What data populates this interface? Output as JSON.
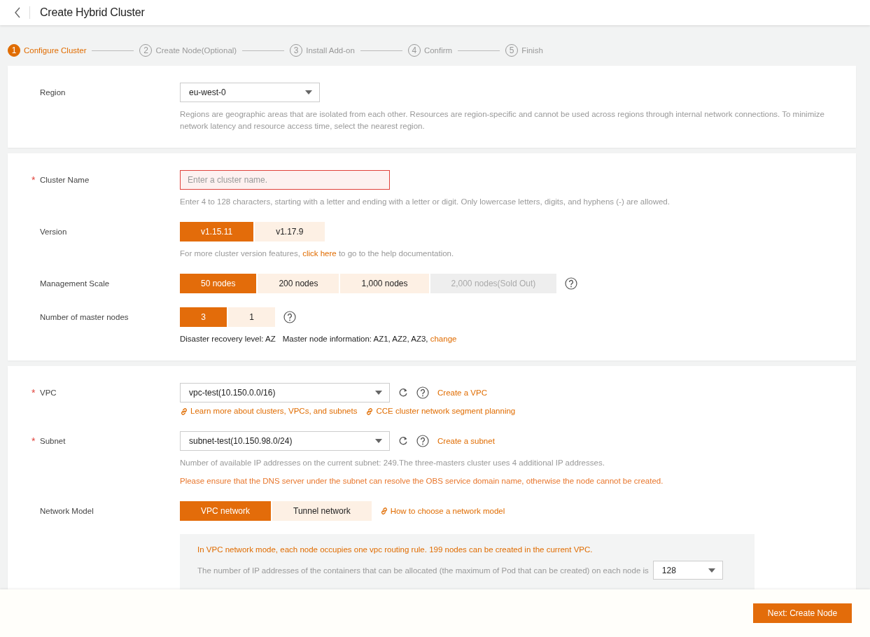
{
  "header": {
    "title": "Create Hybrid Cluster"
  },
  "steps": [
    {
      "number": "1",
      "label": "Configure Cluster",
      "selected": true
    },
    {
      "number": "2",
      "label": "Create Node(Optional)",
      "selected": false
    },
    {
      "number": "3",
      "label": "Install Add-on",
      "selected": false
    },
    {
      "number": "4",
      "label": "Confirm",
      "selected": false
    },
    {
      "number": "5",
      "label": "Finish",
      "selected": false
    }
  ],
  "sections": [
    {
      "rows": [
        {
          "label": "Region",
          "control": {
            "kind": "select",
            "value": "eu-west-0"
          },
          "notes": [
            {
              "kind": "hint",
              "parts": [
                {
                  "kind": "text",
                  "text": "Regions are geographic areas that are isolated from each other. Resources are region-specific and cannot be used across regions through internal network connections. To minimize network latency and resource access time, select the nearest region."
                }
              ]
            }
          ]
        }
      ]
    },
    {
      "rows": [
        {
          "label": "Cluster Name",
          "required_mark": "*",
          "control": {
            "kind": "input",
            "placeholder": "Enter a cluster name.",
            "invalid": true
          },
          "notes": [
            {
              "kind": "hint",
              "parts": [
                {
                  "kind": "text",
                  "text": "Enter 4 to 128 characters, starting with a letter and ending with a letter or digit. Only lowercase letters, digits, and hyphens (-) are allowed."
                }
              ]
            }
          ]
        },
        {
          "label": "Version",
          "control": {
            "kind": "segmented",
            "options": [
              {
                "label": "v1.15.11",
                "selected": true,
                "disabled": false
              },
              {
                "label": "v1.17.9",
                "selected": false,
                "disabled": false
              }
            ]
          },
          "notes": [
            {
              "kind": "hint",
              "parts": [
                {
                  "kind": "text",
                  "text": "For more cluster version features, "
                },
                {
                  "kind": "link",
                  "text": "click here"
                },
                {
                  "kind": "text",
                  "text": " to go to the help documentation."
                }
              ]
            }
          ]
        },
        {
          "label": "Management Scale",
          "control": {
            "kind": "segmented",
            "help": true,
            "options": [
              {
                "label": "50 nodes",
                "selected": true,
                "disabled": false
              },
              {
                "label": "200 nodes",
                "selected": false,
                "disabled": false
              },
              {
                "label": "1,000 nodes",
                "selected": false,
                "disabled": false
              },
              {
                "label": "2,000 nodes(Sold Out)",
                "selected": false,
                "disabled": true
              }
            ]
          }
        },
        {
          "label": "Number of master nodes",
          "control": {
            "kind": "segmented",
            "help": true,
            "options": [
              {
                "label": "3",
                "selected": true,
                "disabled": false
              },
              {
                "label": "1",
                "selected": false,
                "disabled": false
              }
            ]
          },
          "notes": [
            {
              "kind": "dark",
              "parts": [
                {
                  "kind": "text",
                  "text": "Disaster recovery level: AZ"
                },
                {
                  "kind": "text",
                  "text": "Master node information: AZ1, AZ2, AZ3, "
                },
                {
                  "kind": "link",
                  "text": "change"
                }
              ]
            }
          ]
        }
      ]
    },
    {
      "rows": [
        {
          "label": "VPC",
          "required_mark": "*",
          "control": {
            "kind": "select",
            "value": "vpc-test(10.150.0.0/16)",
            "refresh": true,
            "help": true,
            "link": "Create a VPC"
          },
          "notes": [
            {
              "kind": "links",
              "parts": [
                {
                  "kind": "link",
                  "text": "Learn more about clusters, VPCs, and subnets"
                },
                {
                  "kind": "link",
                  "text": "CCE cluster network segment planning"
                }
              ]
            }
          ]
        },
        {
          "label": "Subnet",
          "required_mark": "*",
          "control": {
            "kind": "select",
            "value": "subnet-test(10.150.98.0/24)",
            "refresh": true,
            "help": true,
            "link": "Create a subnet"
          },
          "notes": [
            {
              "kind": "hint",
              "parts": [
                {
                  "kind": "text",
                  "text": "Number of available IP addresses on the current subnet: 249.The three-masters cluster uses 4 additional IP addresses."
                }
              ]
            },
            {
              "kind": "warning",
              "parts": [
                {
                  "kind": "text",
                  "text": "Please ensure that the DNS server under the subnet can resolve the OBS service domain name, otherwise the node cannot be created."
                }
              ]
            }
          ]
        },
        {
          "label": "Network Model",
          "control": {
            "kind": "segmented",
            "link": "How to choose a network model",
            "options": [
              {
                "label": "VPC network",
                "selected": true,
                "disabled": false
              },
              {
                "label": "Tunnel network",
                "selected": false,
                "disabled": false
              }
            ]
          },
          "panel": {
            "info": "In VPC network mode, each node occupies one vpc routing rule. 199 nodes can be created in the current VPC.",
            "text": "The number of IP addresses of the containers that can be allocated (the maximum of Pod that can be created) on each node is",
            "value": "128"
          }
        }
      ]
    }
  ],
  "footer": {
    "button": "Next: Create Node"
  }
}
